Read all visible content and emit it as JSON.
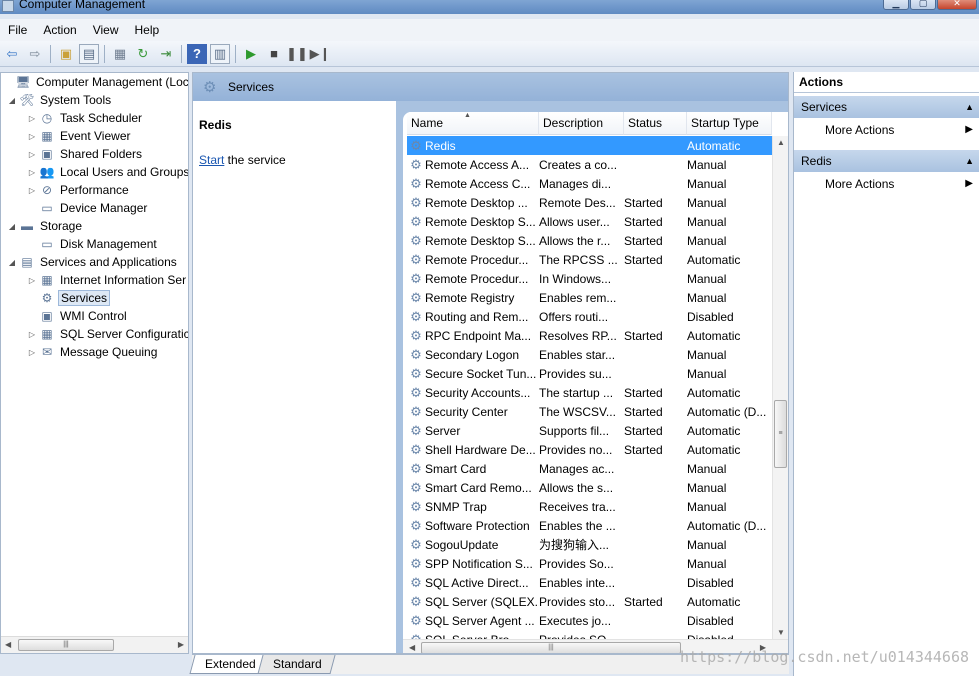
{
  "window": {
    "title": "Computer Management"
  },
  "menu": [
    "File",
    "Action",
    "View",
    "Help"
  ],
  "toolbar": [
    {
      "icon": "back-arrow-icon",
      "glyph": "⇦",
      "color": "#3a78c8"
    },
    {
      "icon": "forward-arrow-icon",
      "glyph": "⇨",
      "color": "#7d8a99"
    },
    {
      "sep": true
    },
    {
      "icon": "up-folder-icon",
      "glyph": "▣",
      "color": "#caa13a"
    },
    {
      "icon": "show-hide-tree-icon",
      "glyph": "▤",
      "color": "#5a6e88",
      "boxed": true
    },
    {
      "sep": true
    },
    {
      "icon": "properties-icon",
      "glyph": "▦",
      "color": "#6f7d90"
    },
    {
      "icon": "refresh-icon",
      "glyph": "↻",
      "color": "#3a9a3a"
    },
    {
      "icon": "export-list-icon",
      "glyph": "⇥",
      "color": "#3a8a3a"
    },
    {
      "sep": true
    },
    {
      "icon": "help-icon",
      "glyph": "?",
      "color": "#ffffff",
      "bg": "#3b66b6"
    },
    {
      "icon": "show-action-pane-icon",
      "glyph": "▥",
      "color": "#5a6e88",
      "boxed": true
    },
    {
      "sep": true
    },
    {
      "icon": "start-service-icon",
      "glyph": "▶",
      "color": "#2e9a2e"
    },
    {
      "icon": "stop-service-icon",
      "glyph": "■",
      "color": "#444444"
    },
    {
      "icon": "pause-service-icon",
      "glyph": "❚❚",
      "color": "#555555"
    },
    {
      "icon": "restart-service-icon",
      "glyph": "▶❙",
      "color": "#555555"
    }
  ],
  "tree": [
    {
      "label": "Computer Management (Local",
      "icon": "computer-icon",
      "glyph": "🖥",
      "level": 0,
      "expander": ""
    },
    {
      "label": "System Tools",
      "icon": "tools-icon",
      "glyph": "🛠",
      "level": 1,
      "expander": "◢"
    },
    {
      "label": "Task Scheduler",
      "icon": "clock-icon",
      "glyph": "◷",
      "level": 2,
      "expander": "▷"
    },
    {
      "label": "Event Viewer",
      "icon": "event-viewer-icon",
      "glyph": "▦",
      "level": 2,
      "expander": "▷"
    },
    {
      "label": "Shared Folders",
      "icon": "shared-folder-icon",
      "glyph": "▣",
      "level": 2,
      "expander": "▷"
    },
    {
      "label": "Local Users and Groups",
      "icon": "users-icon",
      "glyph": "👥",
      "level": 2,
      "expander": "▷"
    },
    {
      "label": "Performance",
      "icon": "performance-icon",
      "glyph": "⊘",
      "level": 2,
      "expander": "▷"
    },
    {
      "label": "Device Manager",
      "icon": "device-manager-icon",
      "glyph": "▭",
      "level": 2,
      "expander": ""
    },
    {
      "label": "Storage",
      "icon": "storage-icon",
      "glyph": "▬",
      "level": 1,
      "expander": "◢"
    },
    {
      "label": "Disk Management",
      "icon": "disk-icon",
      "glyph": "▭",
      "level": 2,
      "expander": ""
    },
    {
      "label": "Services and Applications",
      "icon": "services-apps-icon",
      "glyph": "▤",
      "level": 1,
      "expander": "◢"
    },
    {
      "label": "Internet Information Ser",
      "icon": "iis-icon",
      "glyph": "▦",
      "level": 2,
      "expander": "▷"
    },
    {
      "label": "Services",
      "icon": "services-gear-icon",
      "glyph": "⚙",
      "level": 2,
      "expander": "",
      "selected": true
    },
    {
      "label": "WMI Control",
      "icon": "wmi-icon",
      "glyph": "▣",
      "level": 2,
      "expander": ""
    },
    {
      "label": "SQL Server Configuratic",
      "icon": "sql-config-icon",
      "glyph": "▦",
      "level": 2,
      "expander": "▷"
    },
    {
      "label": "Message Queuing",
      "icon": "message-queue-icon",
      "glyph": "✉",
      "level": 2,
      "expander": "▷"
    }
  ],
  "center": {
    "header_title": "Services",
    "detail": {
      "service_name": "Redis",
      "start_link": "Start",
      "start_suffix": " the service"
    },
    "columns": [
      "Name",
      "Description",
      "Status",
      "Startup Type"
    ],
    "rows": [
      {
        "name": "Redis",
        "desc": "",
        "status": "",
        "startup": "Automatic",
        "selected": true
      },
      {
        "name": "Remote Access A...",
        "desc": "Creates a co...",
        "status": "",
        "startup": "Manual"
      },
      {
        "name": "Remote Access C...",
        "desc": "Manages di...",
        "status": "",
        "startup": "Manual"
      },
      {
        "name": "Remote Desktop ...",
        "desc": "Remote Des...",
        "status": "Started",
        "startup": "Manual"
      },
      {
        "name": "Remote Desktop S...",
        "desc": "Allows user...",
        "status": "Started",
        "startup": "Manual"
      },
      {
        "name": "Remote Desktop S...",
        "desc": "Allows the r...",
        "status": "Started",
        "startup": "Manual"
      },
      {
        "name": "Remote Procedur...",
        "desc": "The RPCSS ...",
        "status": "Started",
        "startup": "Automatic"
      },
      {
        "name": "Remote Procedur...",
        "desc": "In Windows...",
        "status": "",
        "startup": "Manual"
      },
      {
        "name": "Remote Registry",
        "desc": "Enables rem...",
        "status": "",
        "startup": "Manual"
      },
      {
        "name": "Routing and Rem...",
        "desc": "Offers routi...",
        "status": "",
        "startup": "Disabled"
      },
      {
        "name": "RPC Endpoint Ma...",
        "desc": "Resolves RP...",
        "status": "Started",
        "startup": "Automatic"
      },
      {
        "name": "Secondary Logon",
        "desc": "Enables star...",
        "status": "",
        "startup": "Manual"
      },
      {
        "name": "Secure Socket Tun...",
        "desc": "Provides su...",
        "status": "",
        "startup": "Manual"
      },
      {
        "name": "Security Accounts...",
        "desc": "The startup ...",
        "status": "Started",
        "startup": "Automatic"
      },
      {
        "name": "Security Center",
        "desc": "The WSCSV...",
        "status": "Started",
        "startup": "Automatic (D..."
      },
      {
        "name": "Server",
        "desc": "Supports fil...",
        "status": "Started",
        "startup": "Automatic"
      },
      {
        "name": "Shell Hardware De...",
        "desc": "Provides no...",
        "status": "Started",
        "startup": "Automatic"
      },
      {
        "name": "Smart Card",
        "desc": "Manages ac...",
        "status": "",
        "startup": "Manual"
      },
      {
        "name": "Smart Card Remo...",
        "desc": "Allows the s...",
        "status": "",
        "startup": "Manual"
      },
      {
        "name": "SNMP Trap",
        "desc": "Receives tra...",
        "status": "",
        "startup": "Manual"
      },
      {
        "name": "Software Protection",
        "desc": "Enables the ...",
        "status": "",
        "startup": "Automatic (D..."
      },
      {
        "name": "SogouUpdate",
        "desc": "为搜狗输入...",
        "status": "",
        "startup": "Manual"
      },
      {
        "name": "SPP Notification S...",
        "desc": "Provides So...",
        "status": "",
        "startup": "Manual"
      },
      {
        "name": "SQL Active Direct...",
        "desc": "Enables inte...",
        "status": "",
        "startup": "Disabled"
      },
      {
        "name": "SQL Server (SQLEX...",
        "desc": "Provides sto...",
        "status": "Started",
        "startup": "Automatic"
      },
      {
        "name": "SQL Server Agent ...",
        "desc": "Executes jo...",
        "status": "",
        "startup": "Disabled"
      },
      {
        "name": "SQL Server Bro...",
        "desc": "Provides SQ...",
        "status": "",
        "startup": "Disabled"
      }
    ]
  },
  "tabs": {
    "extended": "Extended",
    "standard": "Standard"
  },
  "actions": {
    "title": "Actions",
    "groups": [
      {
        "name": "Services",
        "item": "More Actions"
      },
      {
        "name": "Redis",
        "item": "More Actions"
      }
    ]
  },
  "watermark": "https://blog.csdn.net/u014344668",
  "colors": {
    "selection": "#3399ff",
    "header_blue": "#a9c2e0",
    "link": "#1a56b0"
  }
}
